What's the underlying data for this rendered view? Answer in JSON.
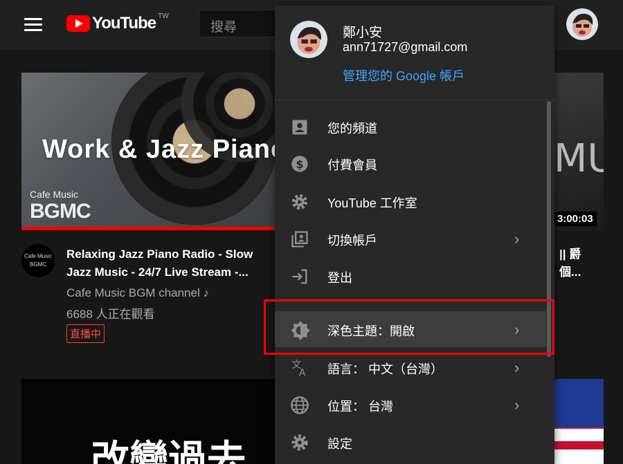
{
  "header": {
    "logo_text": "YouTube",
    "region": "TW",
    "search_placeholder": "搜尋"
  },
  "videos": [
    {
      "thumb_title": "Work & Jazz Piano",
      "thumb_brand": "Cafe Music",
      "thumb_brand2": "BGMC",
      "avatar_text": "Cafe Music BGMC",
      "title": "Relaxing Jazz Piano Radio - Slow Jazz Music - 24/7 Live Stream -...",
      "channel": "Cafe Music BGM channel ♪",
      "views": "6688 人正在觀看",
      "badge": "直播中"
    },
    {
      "thumb_text": "MUSIC",
      "duration": "3:00:03",
      "title": "|| 爵",
      "title2": "個..."
    }
  ],
  "bottom_left_text": "改變過去",
  "account_menu": {
    "name": "鄭小安",
    "email": "ann71727@gmail.com",
    "manage_link": "管理您的 Google 帳戶",
    "items": [
      {
        "label": "您的頻道",
        "icon": "account-box-icon",
        "chevron": false
      },
      {
        "label": "付費會員",
        "icon": "dollar-circle-icon",
        "chevron": false
      },
      {
        "label": "YouTube 工作室",
        "icon": "gear-icon",
        "chevron": false
      },
      {
        "label": "切換帳戶",
        "icon": "switch-account-icon",
        "chevron": true
      },
      {
        "label": "登出",
        "icon": "sign-out-icon",
        "chevron": false
      },
      {
        "label": "深色主題：開啟",
        "icon": "dark-theme-icon",
        "chevron": true
      },
      {
        "label": "語言： 中文（台灣）",
        "icon": "translate-icon",
        "chevron": true
      },
      {
        "label": "位置： 台灣",
        "icon": "globe-icon",
        "chevron": true
      },
      {
        "label": "設定",
        "icon": "settings-gear-icon",
        "chevron": false
      }
    ]
  },
  "colors": {
    "background": "#181818",
    "topbar": "#202020",
    "menu": "#282828",
    "accent_link": "#3ea6ff",
    "brand_red": "#ff0000",
    "highlight_box": "#ff0000"
  }
}
